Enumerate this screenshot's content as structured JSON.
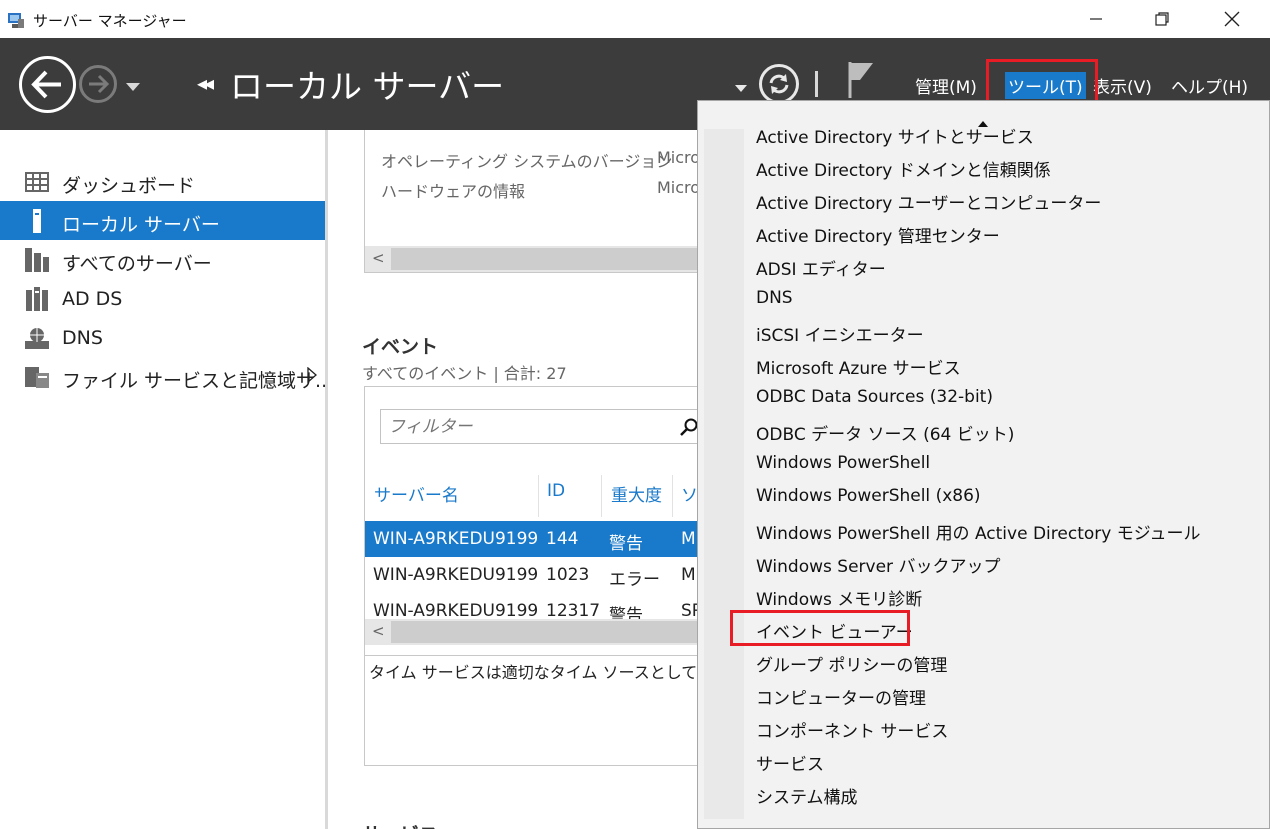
{
  "window": {
    "title": "サーバー マネージャー",
    "controls": [
      "minimize",
      "maximize",
      "close"
    ]
  },
  "header": {
    "chevrons": "◂◂",
    "title": "ローカル サーバー",
    "menus": [
      {
        "label": "管理(M)"
      },
      {
        "label": "ツール(T)",
        "active": true
      },
      {
        "label": "表示(V)"
      },
      {
        "label": "ヘルプ(H)"
      }
    ]
  },
  "sidebar": {
    "items": [
      {
        "label": "ダッシュボード",
        "icon": "dashboard-icon"
      },
      {
        "label": "ローカル サーバー",
        "icon": "local-server-icon",
        "selected": true
      },
      {
        "label": "すべてのサーバー",
        "icon": "all-servers-icon"
      },
      {
        "label": "AD DS",
        "icon": "ad-ds-icon"
      },
      {
        "label": "DNS",
        "icon": "dns-icon"
      },
      {
        "label": "ファイル サービスと記憶域サ...",
        "icon": "file-services-icon",
        "expandable": true
      }
    ]
  },
  "properties": {
    "rows": [
      {
        "label": "オペレーティング システムのバージョン",
        "value": "Micro"
      },
      {
        "label": "ハードウェアの情報",
        "value": "Micro"
      }
    ]
  },
  "events": {
    "title": "イベント",
    "subtitle": "すべてのイベント | 合計: 27",
    "filter_placeholder": "フィルター",
    "columns": [
      "サーバー名",
      "ID",
      "重大度",
      "ソ"
    ],
    "rows": [
      {
        "server": "WIN-A9RKEDU9199",
        "id": "144",
        "severity": "警告",
        "source": "M",
        "selected": true
      },
      {
        "server": "WIN-A9RKEDU9199",
        "id": "1023",
        "severity": "エラー",
        "source": "M"
      },
      {
        "server": "WIN-A9RKEDU9199",
        "id": "12317",
        "severity": "警告",
        "source": "SR"
      }
    ],
    "description": "タイム サービスは適切なタイム ソースとしてクライ"
  },
  "services_title": "サービス",
  "tools_menu": {
    "items": [
      "Active Directory サイトとサービス",
      "Active Directory ドメインと信頼関係",
      "Active Directory ユーザーとコンピューター",
      "Active Directory 管理センター",
      "ADSI エディター",
      "DNS",
      "iSCSI イニシエーター",
      "Microsoft Azure サービス",
      "ODBC Data Sources (32-bit)",
      "ODBC データ ソース (64 ビット)",
      "Windows PowerShell",
      "Windows PowerShell (x86)",
      "Windows PowerShell 用の Active Directory モジュール",
      "Windows Server バックアップ",
      "Windows メモリ診断",
      "イベント ビューアー",
      "グループ ポリシーの管理",
      "コンピューターの管理",
      "コンポーネント サービス",
      "サービス",
      "システム構成"
    ],
    "highlighted": "イベント ビューアー"
  },
  "colors": {
    "header_bg": "#3c3c3c",
    "accent": "#1979ca",
    "highlight_box": "#e81c24",
    "menu_bg": "#f2f2f2"
  }
}
